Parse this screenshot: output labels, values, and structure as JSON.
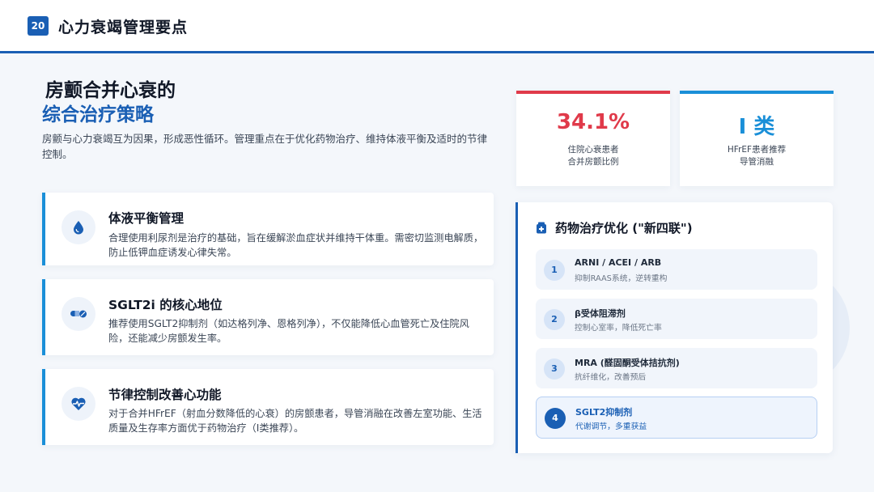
{
  "header": {
    "page_number": "20",
    "title": "心力衰竭管理要点"
  },
  "main": {
    "title_line1": "房颤合并心衰的",
    "title_line2": "综合治疗策略",
    "intro": "房颤与心力衰竭互为因果，形成恶性循环。管理重点在于优化药物治疗、维持体液平衡及适时的节律控制。",
    "cards": [
      {
        "title": "体液平衡管理",
        "text": "合理使用利尿剂是治疗的基础，旨在缓解淤血症状并维持干体重。需密切监测电解质，防止低钾血症诱发心律失常。",
        "icon": "droplet-icon"
      },
      {
        "title": "SGLT2i 的核心地位",
        "text": "推荐使用SGLT2抑制剂（如达格列净、恩格列净），不仅能降低心血管死亡及住院风险，还能减少房颤发生率。",
        "icon": "pills-icon"
      },
      {
        "title": "节律控制改善心功能",
        "text": "对于合并HFrEF（射血分数降低的心衰）的房颤患者，导管消融在改善左室功能、生活质量及生存率方面优于药物治疗（I类推荐）。",
        "icon": "heart-pulse-icon"
      }
    ]
  },
  "stats": [
    {
      "value": "34.1%",
      "label_line1": "住院心衰患者",
      "label_line2": "合并房颤比例",
      "color": "#e03a4a"
    },
    {
      "value": "I 类",
      "label_line1": "HFrEF患者推荐",
      "label_line2": "导管消融",
      "color": "#1a8fd8"
    }
  ],
  "drug_panel": {
    "title": "药物治疗优化 (\"新四联\")",
    "icon": "medicine-box-icon",
    "items": [
      {
        "number": "1",
        "name": "ARNI / ACEI / ARB",
        "desc": "抑制RAAS系统，逆转重构"
      },
      {
        "number": "2",
        "name": "β受体阻滞剂",
        "desc": "控制心室率，降低死亡率"
      },
      {
        "number": "3",
        "name": "MRA (醛固酮受体拮抗剂)",
        "desc": "抗纤维化，改善预后"
      },
      {
        "number": "4",
        "name": "SGLT2抑制剂",
        "desc": "代谢调节，多重获益"
      }
    ]
  }
}
